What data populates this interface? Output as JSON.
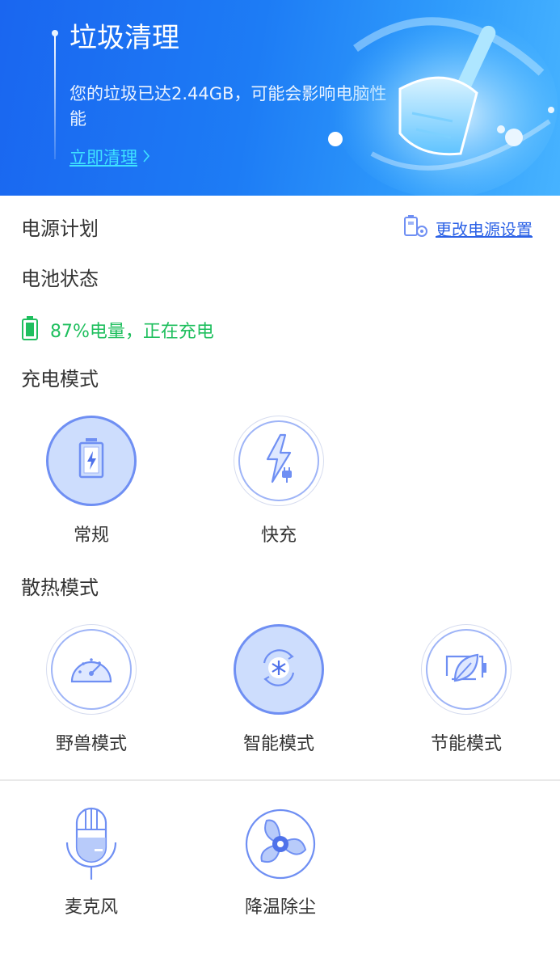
{
  "banner": {
    "title": "垃圾清理",
    "description": "您的垃圾已达2.44GB，可能会影响电脑性能",
    "link_label": "立即清理"
  },
  "power_plan": {
    "label": "电源计划",
    "change_link": "更改电源设置"
  },
  "battery": {
    "label": "电池状态",
    "status_text": "87%电量，正在充电",
    "level_percent": 87
  },
  "charge_mode": {
    "label": "充电模式",
    "options": [
      {
        "label": "常规",
        "selected": true,
        "icon": "battery-charging-icon"
      },
      {
        "label": "快充",
        "selected": false,
        "icon": "fast-charge-icon"
      }
    ]
  },
  "cooling_mode": {
    "label": "散热模式",
    "options": [
      {
        "label": "野兽模式",
        "selected": false,
        "icon": "speedometer-icon"
      },
      {
        "label": "智能模式",
        "selected": true,
        "icon": "snowflake-icon"
      },
      {
        "label": "节能模式",
        "selected": false,
        "icon": "leaf-battery-icon"
      }
    ]
  },
  "tools": [
    {
      "label": "麦克风",
      "icon": "microphone-icon"
    },
    {
      "label": "降温除尘",
      "icon": "fan-icon"
    }
  ],
  "colors": {
    "accent": "#2c62e6",
    "banner_start": "#1a66f0",
    "banner_end": "#47b3ff",
    "battery_green": "#1fbf5e",
    "selected_fill": "#cdddfd",
    "selected_border": "#6f8ff3"
  }
}
